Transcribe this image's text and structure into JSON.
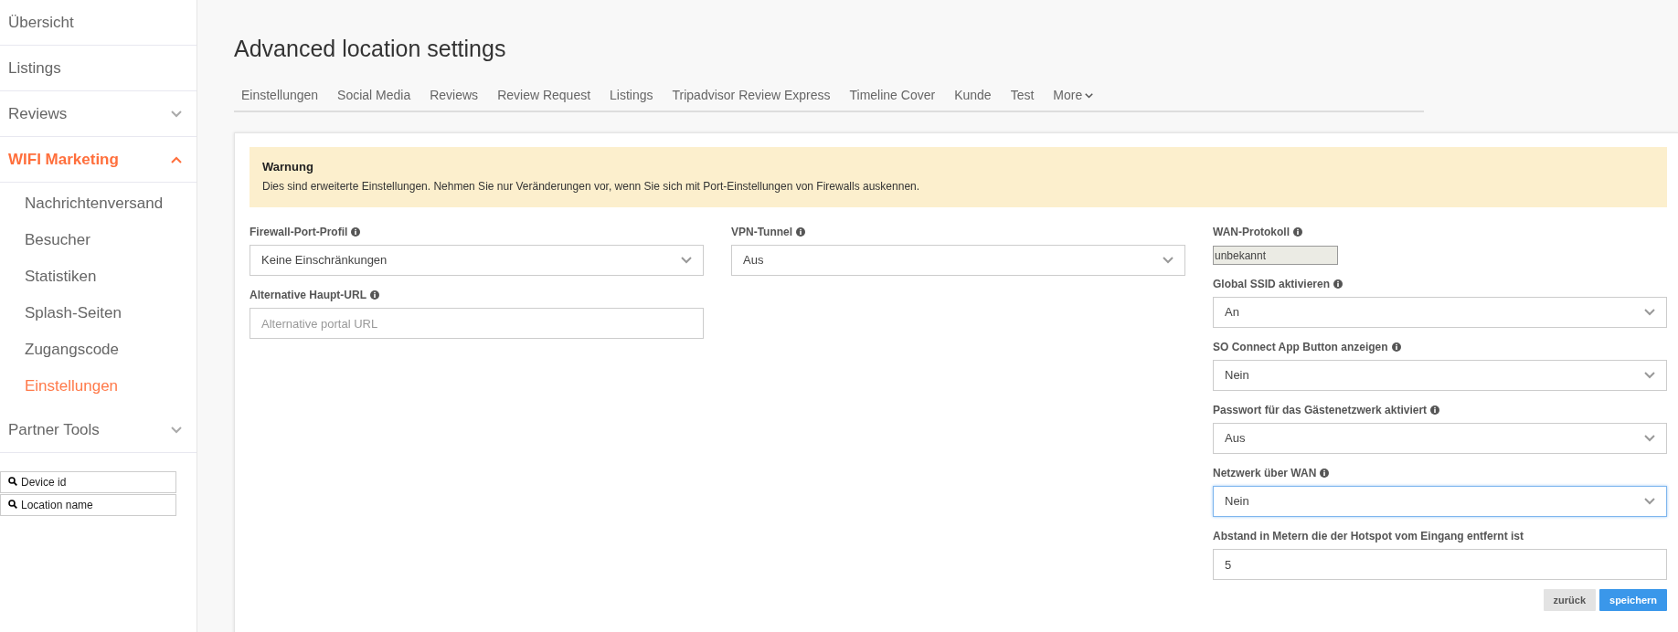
{
  "sidebar": {
    "items": [
      {
        "label": "Übersicht",
        "kind": "link",
        "selected": false
      },
      {
        "label": "Listings",
        "kind": "link",
        "selected": false
      },
      {
        "label": "Reviews",
        "kind": "group",
        "selected": false,
        "expanded": false
      },
      {
        "label": "WIFI Marketing",
        "kind": "group",
        "selected": true,
        "expanded": true,
        "children": [
          {
            "label": "Nachrichtenversand",
            "selected": false
          },
          {
            "label": "Besucher",
            "selected": false
          },
          {
            "label": "Statistiken",
            "selected": false
          },
          {
            "label": "Splash-Seiten",
            "selected": false
          },
          {
            "label": "Zugangscode",
            "selected": false
          },
          {
            "label": "Einstellungen",
            "selected": true
          }
        ]
      },
      {
        "label": "Partner Tools",
        "kind": "group",
        "selected": false,
        "expanded": false
      }
    ],
    "searches": [
      {
        "placeholder": "Device id"
      },
      {
        "placeholder": "Location name"
      }
    ]
  },
  "page": {
    "title": "Advanced location settings",
    "tabs": [
      {
        "label": "Einstellungen"
      },
      {
        "label": "Social Media"
      },
      {
        "label": "Reviews"
      },
      {
        "label": "Review Request"
      },
      {
        "label": "Listings"
      },
      {
        "label": "Tripadvisor Review Express"
      },
      {
        "label": "Timeline Cover"
      },
      {
        "label": "Kunde"
      },
      {
        "label": "Test"
      },
      {
        "label": "More",
        "kind": "dropdown"
      }
    ]
  },
  "warning": {
    "title": "Warnung",
    "text": "Dies sind erweiterte Einstellungen. Nehmen Sie nur Veränderungen vor, wenn Sie sich mit Port-Einstellungen von Firewalls auskennen."
  },
  "columns": [
    [
      {
        "label": "Firewall-Port-Profil",
        "info": true,
        "kind": "select",
        "value": "Keine Einschränkungen",
        "focused": false
      },
      {
        "label": "Alternative Haupt-URL",
        "info": true,
        "kind": "input",
        "placeholder": "Alternative portal URL",
        "focused": false
      }
    ],
    [
      {
        "label": "VPN-Tunnel",
        "info": true,
        "kind": "select",
        "value": "Aus",
        "focused": false
      }
    ],
    [
      {
        "label": "WAN-Protokoll",
        "info": true,
        "kind": "readonly",
        "value": "unbekannt"
      },
      {
        "label": "Global SSID aktivieren",
        "info": true,
        "kind": "select",
        "value": "An",
        "focused": false
      },
      {
        "label": "SO Connect App Button anzeigen",
        "info": true,
        "kind": "select",
        "value": "Nein",
        "focused": false
      },
      {
        "label": "Passwort für das Gästenetzwerk aktiviert",
        "info": true,
        "kind": "select",
        "value": "Aus",
        "focused": false
      },
      {
        "label": "Netzwerk über WAN",
        "info": true,
        "kind": "select",
        "value": "Nein",
        "focused": true
      },
      {
        "label": "Abstand in Metern die der Hotspot vom Eingang entfernt ist",
        "info": false,
        "kind": "input",
        "value": "5",
        "focused": false
      }
    ]
  ],
  "buttons": [
    {
      "label": "zurück",
      "kind": "secondary"
    },
    {
      "label": "speichern",
      "kind": "primary"
    }
  ]
}
